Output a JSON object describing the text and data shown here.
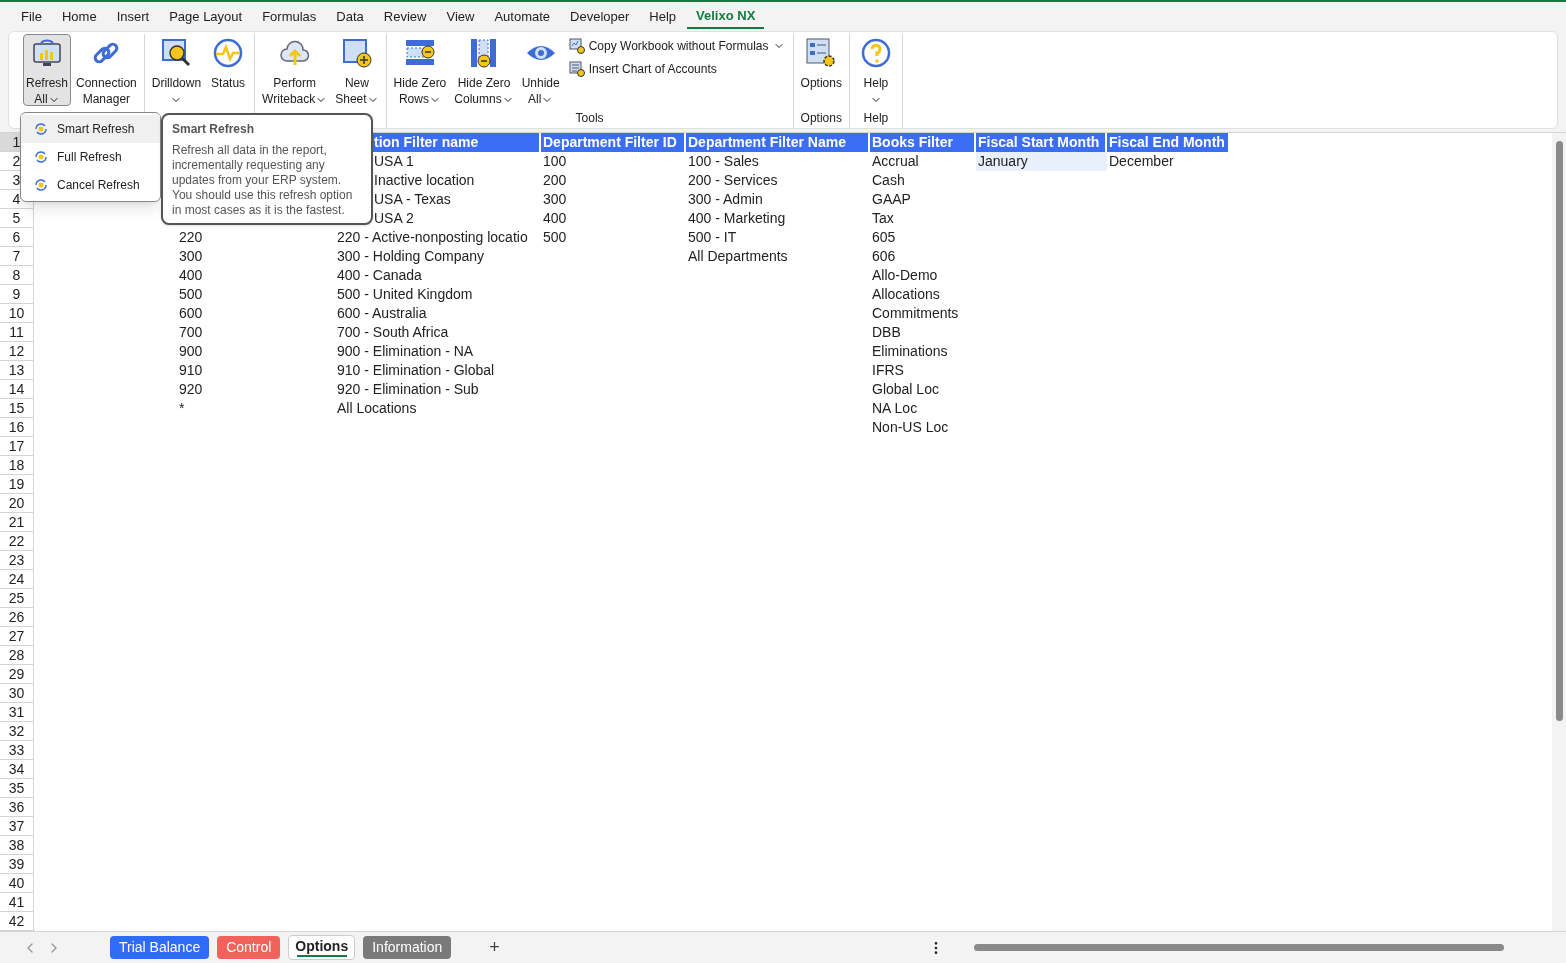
{
  "tabs": [
    {
      "label": "File",
      "selected": false
    },
    {
      "label": "Home",
      "selected": false
    },
    {
      "label": "Insert",
      "selected": false
    },
    {
      "label": "Page Layout",
      "selected": false
    },
    {
      "label": "Formulas",
      "selected": false
    },
    {
      "label": "Data",
      "selected": false
    },
    {
      "label": "Review",
      "selected": false
    },
    {
      "label": "View",
      "selected": false
    },
    {
      "label": "Automate",
      "selected": false
    },
    {
      "label": "Developer",
      "selected": false
    },
    {
      "label": "Help",
      "selected": false
    },
    {
      "label": "Velixo NX",
      "selected": true
    }
  ],
  "ribbon": {
    "groups": [
      {
        "buttons": [
          {
            "kind": "large",
            "lines": [
              "Refresh",
              "All"
            ],
            "dropdown": true,
            "pressed": true
          },
          {
            "kind": "large",
            "lines": [
              "Connection",
              "Manager"
            ],
            "dropdown": false,
            "pressed": false
          }
        ]
      },
      {
        "buttons": [
          {
            "kind": "large",
            "lines": [
              "Drilldown"
            ],
            "dropdown": true,
            "pressed": false
          },
          {
            "kind": "large",
            "lines": [
              "Status"
            ],
            "dropdown": false,
            "pressed": false
          }
        ]
      },
      {
        "buttons": [
          {
            "kind": "large",
            "lines": [
              "Perform",
              "Writeback"
            ],
            "dropdown": true,
            "pressed": false
          },
          {
            "kind": "large",
            "lines": [
              "New",
              "Sheet"
            ],
            "dropdown": true,
            "pressed": false
          }
        ]
      },
      {
        "label": "Tools",
        "buttons": [
          {
            "kind": "large",
            "lines": [
              "Hide Zero",
              "Rows"
            ],
            "dropdown": true,
            "pressed": false
          },
          {
            "kind": "large",
            "lines": [
              "Hide Zero",
              "Columns"
            ],
            "dropdown": true,
            "pressed": false
          },
          {
            "kind": "large",
            "lines": [
              "Unhide",
              "All"
            ],
            "dropdown": true,
            "pressed": false
          },
          {
            "kind": "small",
            "lines": [
              "Copy Workbook without Formulas"
            ],
            "dropdown": true,
            "pressed": false
          },
          {
            "kind": "small",
            "lines": [
              "Insert Chart of Accounts"
            ],
            "dropdown": false,
            "pressed": false
          }
        ]
      },
      {
        "label": "Options",
        "buttons": [
          {
            "kind": "large",
            "lines": [
              "Options"
            ],
            "dropdown": false,
            "pressed": false
          }
        ]
      },
      {
        "label": "Help",
        "buttons": [
          {
            "kind": "large",
            "lines": [
              "Help"
            ],
            "dropdown": true,
            "pressed": false
          }
        ]
      }
    ]
  },
  "menu": {
    "items": [
      {
        "label": "Smart Refresh",
        "selected": true
      },
      {
        "label": "Full Refresh",
        "selected": false
      },
      {
        "label": "Cancel Refresh",
        "selected": false
      }
    ]
  },
  "tooltip": {
    "title": "Smart Refresh",
    "text": "Refresh all data in the report, incrementally requesting any updates from your ERP system. You should use this refresh option in most cases as it is the fastest."
  },
  "grid": {
    "rows": [
      {
        "number": "1",
        "selected": true,
        "kind": "header",
        "cells": [
          null,
          null,
          {
            "text": "tion Filter name",
            "covered": true,
            "selected": false
          },
          {
            "text": "Department Filter ID",
            "selected": false
          },
          {
            "text": "Department Filter Name",
            "selected": false
          },
          {
            "text": "Books Filter",
            "selected": false
          },
          {
            "text": "Fiscal Start Month",
            "selected": false
          },
          {
            "text": "Fiscal End Month",
            "selected": false
          }
        ]
      },
      {
        "number": "2",
        "selected": false,
        "kind": "data",
        "cells": [
          null,
          null,
          {
            "text": "USA 1",
            "covered": true,
            "selected": false
          },
          {
            "text": "100",
            "selected": false
          },
          {
            "text": "100 - Sales",
            "selected": false
          },
          {
            "text": "Accrual",
            "selected": false
          },
          {
            "text": "January",
            "selected": true
          },
          {
            "text": "December",
            "selected": false
          }
        ]
      },
      {
        "number": "3",
        "selected": false,
        "kind": "data",
        "cells": [
          null,
          null,
          {
            "text": "Inactive location",
            "covered": true,
            "selected": false
          },
          {
            "text": "200",
            "selected": false
          },
          {
            "text": "200 - Services",
            "selected": false
          },
          {
            "text": "Cash",
            "selected": false
          },
          null,
          null
        ]
      },
      {
        "number": "4",
        "selected": false,
        "kind": "data",
        "cells": [
          null,
          null,
          {
            "text": "USA - Texas",
            "covered": true,
            "selected": false
          },
          {
            "text": "300",
            "selected": false
          },
          {
            "text": "300 - Admin",
            "selected": false
          },
          {
            "text": "GAAP",
            "selected": false
          },
          null,
          null
        ]
      },
      {
        "number": "5",
        "selected": false,
        "kind": "data",
        "cells": [
          null,
          null,
          {
            "text": "USA 2",
            "covered": true,
            "selected": false
          },
          {
            "text": "400",
            "selected": false
          },
          {
            "text": "400 - Marketing",
            "selected": false
          },
          {
            "text": "Tax",
            "selected": false
          },
          null,
          null
        ]
      },
      {
        "number": "6",
        "selected": false,
        "kind": "data",
        "cells": [
          null,
          {
            "text": "220",
            "selected": false
          },
          {
            "text": "220 - Active-nonposting locatio",
            "selected": false
          },
          {
            "text": "500",
            "selected": false
          },
          {
            "text": "500 - IT",
            "selected": false
          },
          {
            "text": "605",
            "selected": false
          },
          null,
          null
        ]
      },
      {
        "number": "7",
        "selected": false,
        "kind": "data",
        "cells": [
          null,
          {
            "text": "300",
            "selected": false
          },
          {
            "text": "300 - Holding Company",
            "selected": false
          },
          null,
          {
            "text": "All Departments",
            "selected": false
          },
          {
            "text": "606",
            "selected": false
          },
          null,
          null
        ]
      },
      {
        "number": "8",
        "selected": false,
        "kind": "data",
        "cells": [
          null,
          {
            "text": "400",
            "selected": false
          },
          {
            "text": "400 - Canada",
            "selected": false
          },
          null,
          null,
          {
            "text": "Allo-Demo",
            "selected": false
          },
          null,
          null
        ]
      },
      {
        "number": "9",
        "selected": false,
        "kind": "data",
        "cells": [
          null,
          {
            "text": "500",
            "selected": false
          },
          {
            "text": "500 - United Kingdom",
            "selected": false
          },
          null,
          null,
          {
            "text": "Allocations",
            "selected": false
          },
          null,
          null
        ]
      },
      {
        "number": "10",
        "selected": false,
        "kind": "data",
        "cells": [
          null,
          {
            "text": "600",
            "selected": false
          },
          {
            "text": "600 - Australia",
            "selected": false
          },
          null,
          null,
          {
            "text": "Commitments",
            "selected": false
          },
          null,
          null
        ]
      },
      {
        "number": "11",
        "selected": false,
        "kind": "data",
        "cells": [
          null,
          {
            "text": "700",
            "selected": false
          },
          {
            "text": "700 - South Africa",
            "selected": false
          },
          null,
          null,
          {
            "text": "DBB",
            "selected": false
          },
          null,
          null
        ]
      },
      {
        "number": "12",
        "selected": false,
        "kind": "data",
        "cells": [
          null,
          {
            "text": "900",
            "selected": false
          },
          {
            "text": "900 - Elimination - NA",
            "selected": false
          },
          null,
          null,
          {
            "text": "Eliminations",
            "selected": false
          },
          null,
          null
        ]
      },
      {
        "number": "13",
        "selected": false,
        "kind": "data",
        "cells": [
          null,
          {
            "text": "910",
            "selected": false
          },
          {
            "text": "910 - Elimination - Global",
            "selected": false
          },
          null,
          null,
          {
            "text": "IFRS",
            "selected": false
          },
          null,
          null
        ]
      },
      {
        "number": "14",
        "selected": false,
        "kind": "data",
        "cells": [
          null,
          {
            "text": "920",
            "selected": false
          },
          {
            "text": "920 - Elimination - Sub",
            "selected": false
          },
          null,
          null,
          {
            "text": "Global Loc",
            "selected": false
          },
          null,
          null
        ]
      },
      {
        "number": "15",
        "selected": false,
        "kind": "data",
        "cells": [
          null,
          {
            "text": "*",
            "selected": false
          },
          {
            "text": "All Locations",
            "selected": false
          },
          null,
          null,
          {
            "text": "NA Loc",
            "selected": false
          },
          null,
          null
        ]
      },
      {
        "number": "16",
        "selected": false,
        "kind": "data",
        "cells": [
          null,
          null,
          null,
          null,
          null,
          {
            "text": "Non-US Loc",
            "selected": false
          },
          null,
          null
        ]
      },
      {
        "number": "17",
        "selected": false
      },
      {
        "number": "18",
        "selected": false
      },
      {
        "number": "19",
        "selected": false
      },
      {
        "number": "20",
        "selected": false
      },
      {
        "number": "21",
        "selected": false
      },
      {
        "number": "22",
        "selected": false
      },
      {
        "number": "23",
        "selected": false
      },
      {
        "number": "24",
        "selected": false
      },
      {
        "number": "25",
        "selected": false
      },
      {
        "number": "26",
        "selected": false
      },
      {
        "number": "27",
        "selected": false
      },
      {
        "number": "28",
        "selected": false
      },
      {
        "number": "29",
        "selected": false
      },
      {
        "number": "30",
        "selected": false
      },
      {
        "number": "31",
        "selected": false
      },
      {
        "number": "32",
        "selected": false
      },
      {
        "number": "33",
        "selected": false
      },
      {
        "number": "34",
        "selected": false
      },
      {
        "number": "35",
        "selected": false
      },
      {
        "number": "36",
        "selected": false
      },
      {
        "number": "37",
        "selected": false
      },
      {
        "number": "38",
        "selected": false
      },
      {
        "number": "39",
        "selected": false
      },
      {
        "number": "40",
        "selected": false
      },
      {
        "number": "41",
        "selected": false
      },
      {
        "number": "42",
        "selected": false
      }
    ]
  },
  "sheet_tabs": [
    {
      "label": "Trial Balance",
      "color": "#2f6cf6",
      "selected": false
    },
    {
      "label": "Control",
      "color": "#f1625a",
      "selected": false
    },
    {
      "label": "Options",
      "color": "#107c41",
      "selected": true
    },
    {
      "label": "Information",
      "color": "#7a7a7a",
      "selected": false
    }
  ],
  "add_sheet": "+"
}
